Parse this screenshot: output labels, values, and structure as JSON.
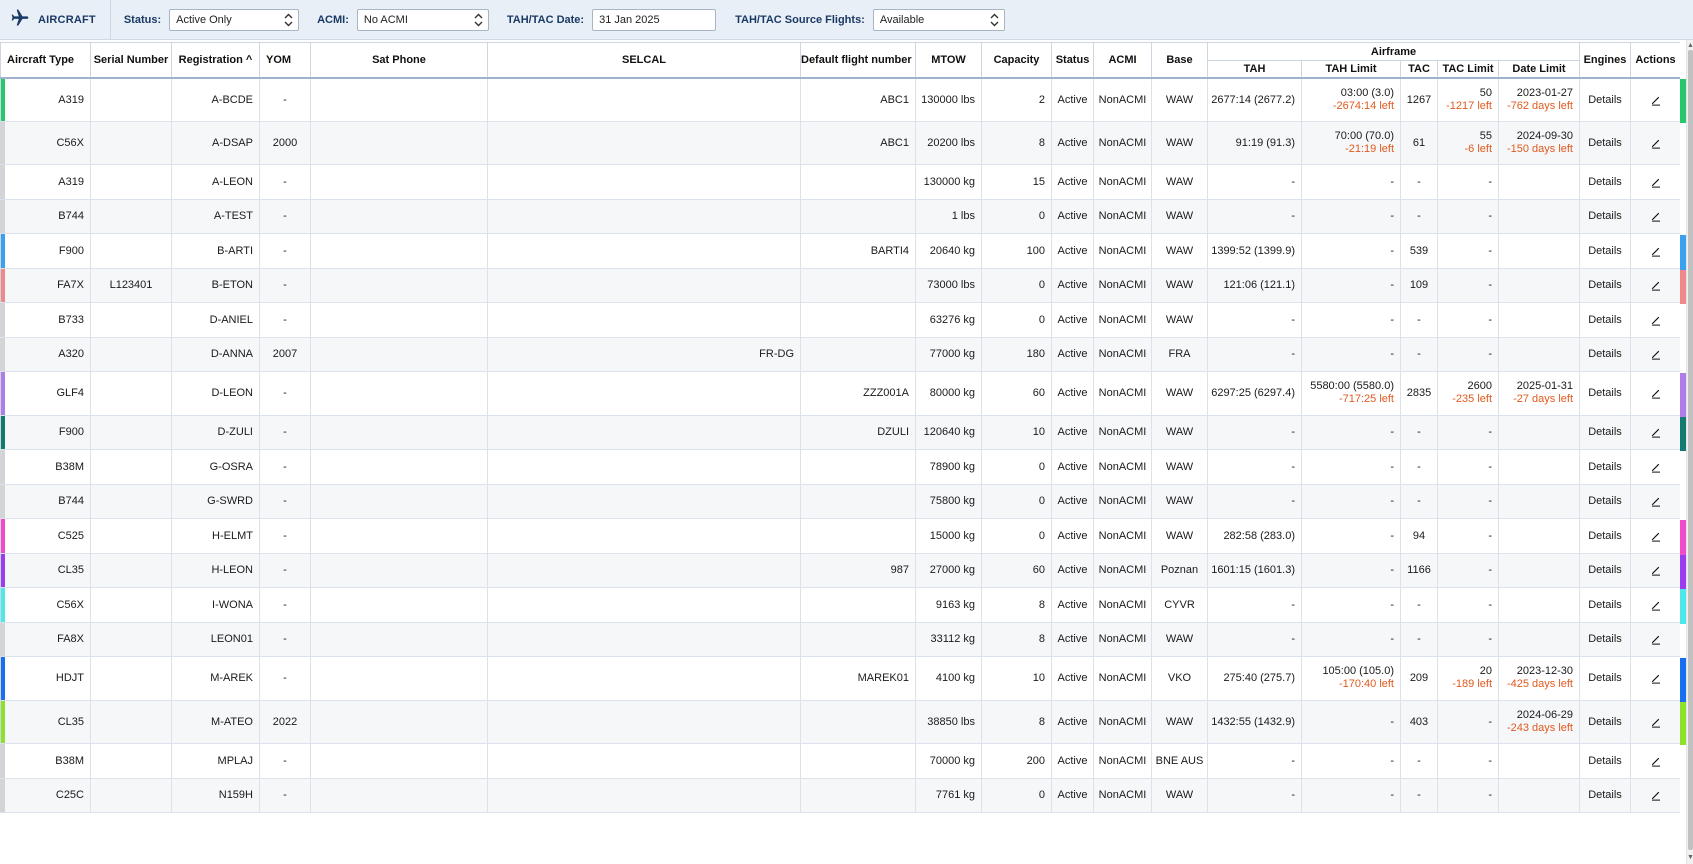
{
  "toolbar": {
    "title": "AIRCRAFT",
    "status_label": "Status:",
    "status_value": "Active Only",
    "acmi_label": "ACMI:",
    "acmi_value": "No ACMI",
    "date_label": "TAH/TAC Date:",
    "date_value": "31 Jan 2025",
    "source_label": "TAH/TAC Source Flights:",
    "source_value": "Available"
  },
  "columns": {
    "type": "Aircraft Type",
    "serial": "Serial Number",
    "reg": "Registration",
    "sort_indicator": "^",
    "yom": "YOM",
    "sat": "Sat Phone",
    "selcal": "SELCAL",
    "dfn": "Default flight number",
    "mtow": "MTOW",
    "cap": "Capacity",
    "status": "Status",
    "acmi": "ACMI",
    "base": "Base",
    "airframe": "Airframe",
    "tah": "TAH",
    "tahlimit": "TAH Limit",
    "tac": "TAC",
    "taclimit": "TAC Limit",
    "datelimit": "Date Limit",
    "engines": "Engines",
    "actions": "Actions"
  },
  "details_label": "Details",
  "rows": [
    {
      "type": "A319",
      "serial": "",
      "reg": "A-BCDE",
      "yom": "-",
      "sat": "",
      "selcal": "",
      "dfn": "ABC1",
      "mtow": "130000 lbs",
      "cap": "2",
      "status": "Active",
      "acmi": "NonACMI",
      "base": "WAW",
      "tah": "2677:14 (2677.2)",
      "tahlimit": "03:00 (3.0)",
      "tahlimit_left": "-2674:14 left",
      "tac": "1267",
      "taclimit": "50",
      "taclimit_left": "-1217 left",
      "datelimit": "2023-01-27",
      "datelimit_left": "-762 days left",
      "color": "#27c76b"
    },
    {
      "type": "C56X",
      "serial": "",
      "reg": "A-DSAP",
      "yom": "2000",
      "sat": "",
      "selcal": "",
      "dfn": "ABC1",
      "mtow": "20200 lbs",
      "cap": "8",
      "status": "Active",
      "acmi": "NonACMI",
      "base": "WAW",
      "tah": "91:19 (91.3)",
      "tahlimit": "70:00 (70.0)",
      "tahlimit_left": "-21:19 left",
      "tac": "61",
      "taclimit": "55",
      "taclimit_left": "-6 left",
      "datelimit": "2024-09-30",
      "datelimit_left": "-150 days left",
      "color": "#d4d4d4"
    },
    {
      "type": "A319",
      "serial": "",
      "reg": "A-LEON",
      "yom": "-",
      "sat": "",
      "selcal": "",
      "dfn": "",
      "mtow": "130000 kg",
      "cap": "15",
      "status": "Active",
      "acmi": "NonACMI",
      "base": "WAW",
      "tah": "-",
      "tahlimit": "-",
      "tahlimit_left": "",
      "tac": "-",
      "taclimit": "-",
      "taclimit_left": "",
      "datelimit": "",
      "datelimit_left": "",
      "color": "#d4d4d4"
    },
    {
      "type": "B744",
      "serial": "",
      "reg": "A-TEST",
      "yom": "-",
      "sat": "",
      "selcal": "",
      "dfn": "",
      "mtow": "1 lbs",
      "cap": "0",
      "status": "Active",
      "acmi": "NonACMI",
      "base": "WAW",
      "tah": "-",
      "tahlimit": "-",
      "tahlimit_left": "",
      "tac": "-",
      "taclimit": "-",
      "taclimit_left": "",
      "datelimit": "",
      "datelimit_left": "",
      "color": "#d4d4d4"
    },
    {
      "type": "F900",
      "serial": "",
      "reg": "B-ARTI",
      "yom": "-",
      "sat": "",
      "selcal": "",
      "dfn": "BARTI4",
      "mtow": "20640 kg",
      "cap": "100",
      "status": "Active",
      "acmi": "NonACMI",
      "base": "WAW",
      "tah": "1399:52 (1399.9)",
      "tahlimit": "-",
      "tahlimit_left": "",
      "tac": "539",
      "taclimit": "-",
      "taclimit_left": "",
      "datelimit": "",
      "datelimit_left": "",
      "color": "#3aa0f0"
    },
    {
      "type": "FA7X",
      "serial": "L123401",
      "reg": "B-ETON",
      "yom": "-",
      "sat": "",
      "selcal": "",
      "dfn": "",
      "mtow": "73000 lbs",
      "cap": "0",
      "status": "Active",
      "acmi": "NonACMI",
      "base": "WAW",
      "tah": "121:06 (121.1)",
      "tahlimit": "-",
      "tahlimit_left": "",
      "tac": "109",
      "taclimit": "-",
      "taclimit_left": "",
      "datelimit": "",
      "datelimit_left": "",
      "color": "#f08a8a"
    },
    {
      "type": "B733",
      "serial": "",
      "reg": "D-ANIEL",
      "yom": "-",
      "sat": "",
      "selcal": "",
      "dfn": "",
      "mtow": "63276 kg",
      "cap": "0",
      "status": "Active",
      "acmi": "NonACMI",
      "base": "WAW",
      "tah": "-",
      "tahlimit": "-",
      "tahlimit_left": "",
      "tac": "-",
      "taclimit": "-",
      "taclimit_left": "",
      "datelimit": "",
      "datelimit_left": "",
      "color": "#d4d4d4"
    },
    {
      "type": "A320",
      "serial": "",
      "reg": "D-ANNA",
      "yom": "2007",
      "sat": "",
      "selcal": "FR-DG",
      "dfn": "",
      "mtow": "77000 kg",
      "cap": "180",
      "status": "Active",
      "acmi": "NonACMI",
      "base": "FRA",
      "tah": "-",
      "tahlimit": "-",
      "tahlimit_left": "",
      "tac": "-",
      "taclimit": "-",
      "taclimit_left": "",
      "datelimit": "",
      "datelimit_left": "",
      "color": "#d4d4d4"
    },
    {
      "type": "GLF4",
      "serial": "",
      "reg": "D-LEON",
      "yom": "-",
      "sat": "",
      "selcal": "",
      "dfn": "ZZZ001A",
      "mtow": "80000 kg",
      "cap": "60",
      "status": "Active",
      "acmi": "NonACMI",
      "base": "WAW",
      "tah": "6297:25 (6297.4)",
      "tahlimit": "5580:00 (5580.0)",
      "tahlimit_left": "-717:25 left",
      "tac": "2835",
      "taclimit": "2600",
      "taclimit_left": "-235 left",
      "datelimit": "2025-01-31",
      "datelimit_left": "-27 days left",
      "color": "#b07de8"
    },
    {
      "type": "F900",
      "serial": "",
      "reg": "D-ZULI",
      "yom": "-",
      "sat": "",
      "selcal": "",
      "dfn": "DZULI",
      "mtow": "120640 kg",
      "cap": "10",
      "status": "Active",
      "acmi": "NonACMI",
      "base": "WAW",
      "tah": "-",
      "tahlimit": "-",
      "tahlimit_left": "",
      "tac": "-",
      "taclimit": "-",
      "taclimit_left": "",
      "datelimit": "",
      "datelimit_left": "",
      "color": "#137a72"
    },
    {
      "type": "B38M",
      "serial": "",
      "reg": "G-OSRA",
      "yom": "-",
      "sat": "",
      "selcal": "",
      "dfn": "",
      "mtow": "78900 kg",
      "cap": "0",
      "status": "Active",
      "acmi": "NonACMI",
      "base": "WAW",
      "tah": "-",
      "tahlimit": "-",
      "tahlimit_left": "",
      "tac": "-",
      "taclimit": "-",
      "taclimit_left": "",
      "datelimit": "",
      "datelimit_left": "",
      "color": "#d4d4d4"
    },
    {
      "type": "B744",
      "serial": "",
      "reg": "G-SWRD",
      "yom": "-",
      "sat": "",
      "selcal": "",
      "dfn": "",
      "mtow": "75800 kg",
      "cap": "0",
      "status": "Active",
      "acmi": "NonACMI",
      "base": "WAW",
      "tah": "-",
      "tahlimit": "-",
      "tahlimit_left": "",
      "tac": "-",
      "taclimit": "-",
      "taclimit_left": "",
      "datelimit": "",
      "datelimit_left": "",
      "color": "#d4d4d4"
    },
    {
      "type": "C525",
      "serial": "",
      "reg": "H-ELMT",
      "yom": "-",
      "sat": "",
      "selcal": "",
      "dfn": "",
      "mtow": "15000 kg",
      "cap": "0",
      "status": "Active",
      "acmi": "NonACMI",
      "base": "WAW",
      "tah": "282:58 (283.0)",
      "tahlimit": "-",
      "tahlimit_left": "",
      "tac": "94",
      "taclimit": "-",
      "taclimit_left": "",
      "datelimit": "",
      "datelimit_left": "",
      "color": "#f04bc8"
    },
    {
      "type": "CL35",
      "serial": "",
      "reg": "H-LEON",
      "yom": "-",
      "sat": "",
      "selcal": "",
      "dfn": "987",
      "mtow": "27000 kg",
      "cap": "60",
      "status": "Active",
      "acmi": "NonACMI",
      "base": "Poznan",
      "tah": "1601:15 (1601.3)",
      "tahlimit": "-",
      "tahlimit_left": "",
      "tac": "1166",
      "taclimit": "-",
      "taclimit_left": "",
      "datelimit": "",
      "datelimit_left": "",
      "color": "#9a3cf0"
    },
    {
      "type": "C56X",
      "serial": "",
      "reg": "I-WONA",
      "yom": "-",
      "sat": "",
      "selcal": "",
      "dfn": "",
      "mtow": "9163 kg",
      "cap": "8",
      "status": "Active",
      "acmi": "NonACMI",
      "base": "CYVR",
      "tah": "-",
      "tahlimit": "-",
      "tahlimit_left": "",
      "tac": "-",
      "taclimit": "-",
      "taclimit_left": "",
      "datelimit": "",
      "datelimit_left": "",
      "color": "#4ee8ea"
    },
    {
      "type": "FA8X",
      "serial": "",
      "reg": "LEON01",
      "yom": "-",
      "sat": "",
      "selcal": "",
      "dfn": "",
      "mtow": "33112 kg",
      "cap": "8",
      "status": "Active",
      "acmi": "NonACMI",
      "base": "WAW",
      "tah": "-",
      "tahlimit": "-",
      "tahlimit_left": "",
      "tac": "-",
      "taclimit": "-",
      "taclimit_left": "",
      "datelimit": "",
      "datelimit_left": "",
      "color": "#d4d4d4"
    },
    {
      "type": "HDJT",
      "serial": "",
      "reg": "M-AREK",
      "yom": "-",
      "sat": "",
      "selcal": "",
      "dfn": "MAREK01",
      "mtow": "4100 kg",
      "cap": "10",
      "status": "Active",
      "acmi": "NonACMI",
      "base": "VKO",
      "tah": "275:40 (275.7)",
      "tahlimit": "105:00 (105.0)",
      "tahlimit_left": "-170:40 left",
      "tac": "209",
      "taclimit": "20",
      "taclimit_left": "-189 left",
      "datelimit": "2023-12-30",
      "datelimit_left": "-425 days left",
      "color": "#1a6ef0"
    },
    {
      "type": "CL35",
      "serial": "",
      "reg": "M-ATEO",
      "yom": "2022",
      "sat": "",
      "selcal": "",
      "dfn": "",
      "mtow": "38850 lbs",
      "cap": "8",
      "status": "Active",
      "acmi": "NonACMI",
      "base": "WAW",
      "tah": "1432:55 (1432.9)",
      "tahlimit": "-",
      "tahlimit_left": "",
      "tac": "403",
      "taclimit": "-",
      "taclimit_left": "",
      "datelimit": "2024-06-29",
      "datelimit_left": "-243 days left",
      "color": "#8ee02a"
    },
    {
      "type": "B38M",
      "serial": "",
      "reg": "MPLAJ",
      "yom": "-",
      "sat": "",
      "selcal": "",
      "dfn": "",
      "mtow": "70000 kg",
      "cap": "200",
      "status": "Active",
      "acmi": "NonACMI",
      "base": "BNE AUS",
      "tah": "-",
      "tahlimit": "-",
      "tahlimit_left": "",
      "tac": "-",
      "taclimit": "-",
      "taclimit_left": "",
      "datelimit": "",
      "datelimit_left": "",
      "color": "#d4d4d4"
    },
    {
      "type": "C25C",
      "serial": "",
      "reg": "N159H",
      "yom": "-",
      "sat": "",
      "selcal": "",
      "dfn": "",
      "mtow": "7761 kg",
      "cap": "0",
      "status": "Active",
      "acmi": "NonACMI",
      "base": "WAW",
      "tah": "-",
      "tahlimit": "-",
      "tahlimit_left": "",
      "tac": "-",
      "taclimit": "-",
      "taclimit_left": "",
      "datelimit": "",
      "datelimit_left": "",
      "color": "#d4d4d4"
    }
  ]
}
